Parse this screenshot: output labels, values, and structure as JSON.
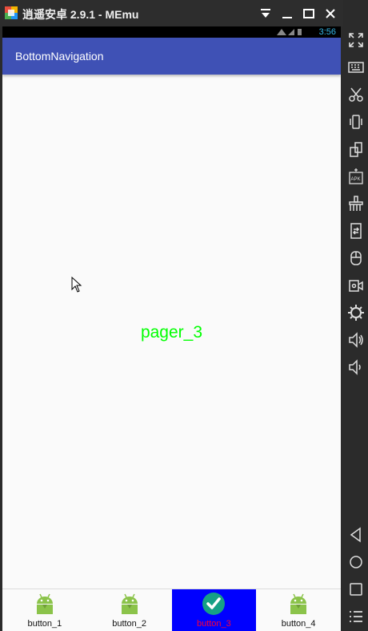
{
  "window": {
    "title": "逍遥安卓 2.9.1 - MEmu"
  },
  "statusbar": {
    "time": "3:56"
  },
  "appbar": {
    "title": "BottomNavigation"
  },
  "pager": {
    "label": "pager_3"
  },
  "bottom_nav": {
    "items": [
      {
        "label": "button_1",
        "icon": "android-icon",
        "active": false
      },
      {
        "label": "button_2",
        "icon": "android-icon",
        "active": false
      },
      {
        "label": "button_3",
        "icon": "check-icon",
        "active": true
      },
      {
        "label": "button_4",
        "icon": "android-icon",
        "active": false
      }
    ]
  },
  "toolbar_icons": [
    "fullscreen-icon",
    "keyboard-icon",
    "scissors-icon",
    "shake-icon",
    "rotate-icon",
    "apk-icon",
    "broom-icon",
    "sync-icon",
    "storage-icon",
    "camera-icon",
    "settings-icon",
    "volume-up-icon",
    "volume-down-icon",
    "back-icon",
    "home-icon",
    "recents-icon",
    "menu-icon"
  ],
  "colors": {
    "appbar": "#3f51b5",
    "pager_label": "#00ff00",
    "active_nav": "#0000ff",
    "active_label": "#ff0033"
  }
}
